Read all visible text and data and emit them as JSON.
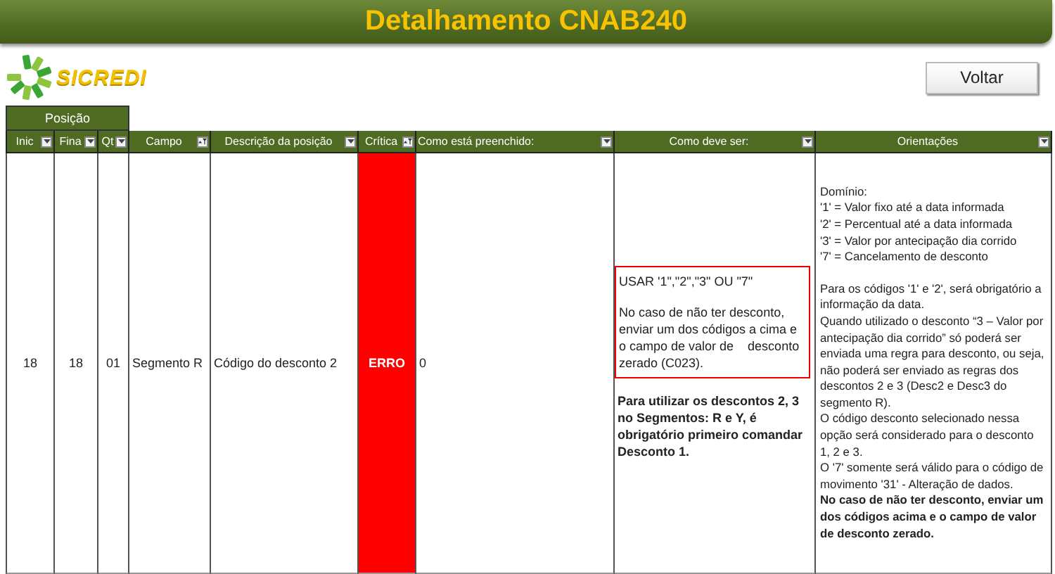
{
  "title": "Detalhamento CNAB240",
  "logo_text": "SICREDI",
  "back_button": "Voltar",
  "group_header": "Posição",
  "columns": [
    {
      "label": "Inic",
      "filtered": false
    },
    {
      "label": "Fina",
      "filtered": false
    },
    {
      "label": "Qt",
      "filtered": false
    },
    {
      "label": "Campo",
      "filtered": true
    },
    {
      "label": "Descrição da posição",
      "filtered": false
    },
    {
      "label": "Crítica",
      "filtered": true
    },
    {
      "label": "Como está preenchido:",
      "filtered": false
    },
    {
      "label": "Como deve ser:",
      "filtered": false
    },
    {
      "label": "Orientações",
      "filtered": false
    }
  ],
  "row": {
    "inicio": "18",
    "final": "18",
    "qtd": "01",
    "campo": "Segmento R",
    "descricao": "Código do desconto 2",
    "critica": "ERRO",
    "preenchido": "0",
    "como_deve_ser": {
      "boxed": [
        "USAR '1\",\"2\",\"3\" OU \"7\"",
        "No caso de não ter desconto, enviar um dos códigos a cima e o campo de valor de    desconto zerado (C023)."
      ],
      "note": "Para utilizar os descontos 2, 3 no Segmentos: R e Y, é obrigatório primeiro comandar Desconto 1."
    },
    "orientacoes": [
      {
        "kind": "plain",
        "text": "Domínio:"
      },
      {
        "kind": "plain",
        "text": "'1' = Valor fixo até a data informada"
      },
      {
        "kind": "plain",
        "text": "'2' = Percentual até a data informada"
      },
      {
        "kind": "plain",
        "text": "'3' = Valor por antecipação dia corrido"
      },
      {
        "kind": "plain",
        "text": "'7' = Cancelamento de desconto"
      },
      {
        "kind": "gap"
      },
      {
        "kind": "plain",
        "text": "Para os códigos '1' e '2', será obrigatório a informação da data."
      },
      {
        "kind": "plain",
        "text": "Quando utilizado o desconto “3 – Valor por antecipação dia corrido” só poderá ser enviada uma regra para desconto, ou seja, não poderá ser enviado as regras dos descontos 2 e 3 (Desc2 e Desc3 do segmento R)."
      },
      {
        "kind": "plain",
        "text": "O código desconto selecionado nessa opção será considerado para o desconto 1, 2 e 3."
      },
      {
        "kind": "plain",
        "text": "O '7' somente será válido para o código de movimento '31' - Alteração de dados."
      },
      {
        "kind": "bold",
        "text": "No caso de não ter desconto, enviar um dos códigos acima e o campo de valor de desconto zerado."
      }
    ]
  }
}
